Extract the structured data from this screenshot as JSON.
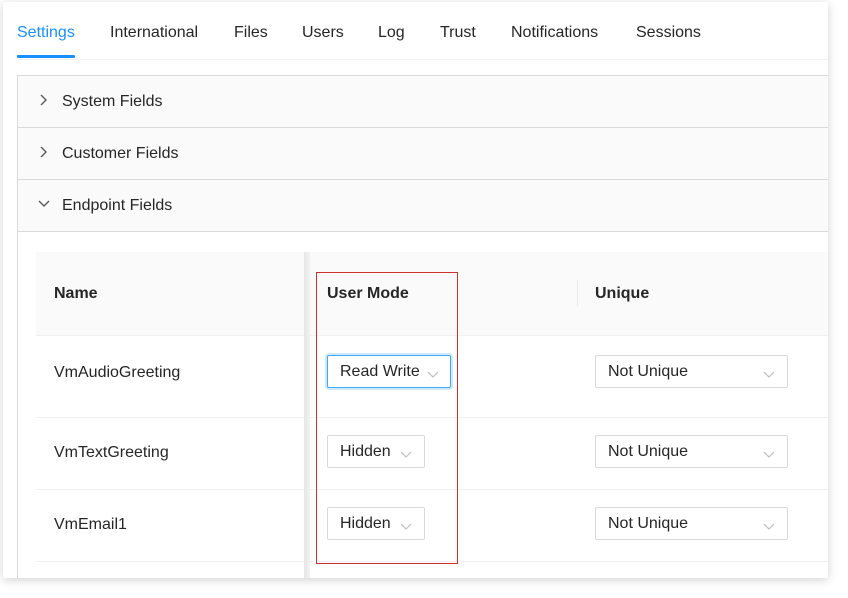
{
  "tabs": [
    {
      "label": "Settings",
      "active": true
    },
    {
      "label": "International"
    },
    {
      "label": "Files"
    },
    {
      "label": "Users"
    },
    {
      "label": "Log"
    },
    {
      "label": "Trust"
    },
    {
      "label": "Notifications"
    },
    {
      "label": "Sessions"
    }
  ],
  "panels": [
    {
      "title": "System Fields",
      "expanded": false,
      "icon": "chevron-right-icon"
    },
    {
      "title": "Customer Fields",
      "expanded": false,
      "icon": "chevron-right-icon"
    },
    {
      "title": "Endpoint Fields",
      "expanded": true,
      "icon": "chevron-down-icon"
    }
  ],
  "table": {
    "columns": [
      "Name",
      "User Mode",
      "Unique"
    ],
    "rows": [
      {
        "name": "VmAudioGreeting",
        "user_mode": "Read Write",
        "unique": "Not Unique"
      },
      {
        "name": "VmTextGreeting",
        "user_mode": "Hidden",
        "unique": "Not Unique"
      },
      {
        "name": "VmEmail1",
        "user_mode": "Hidden",
        "unique": "Not Unique"
      }
    ]
  },
  "colors": {
    "accent": "#1890ff",
    "highlight": "#d0312d"
  }
}
